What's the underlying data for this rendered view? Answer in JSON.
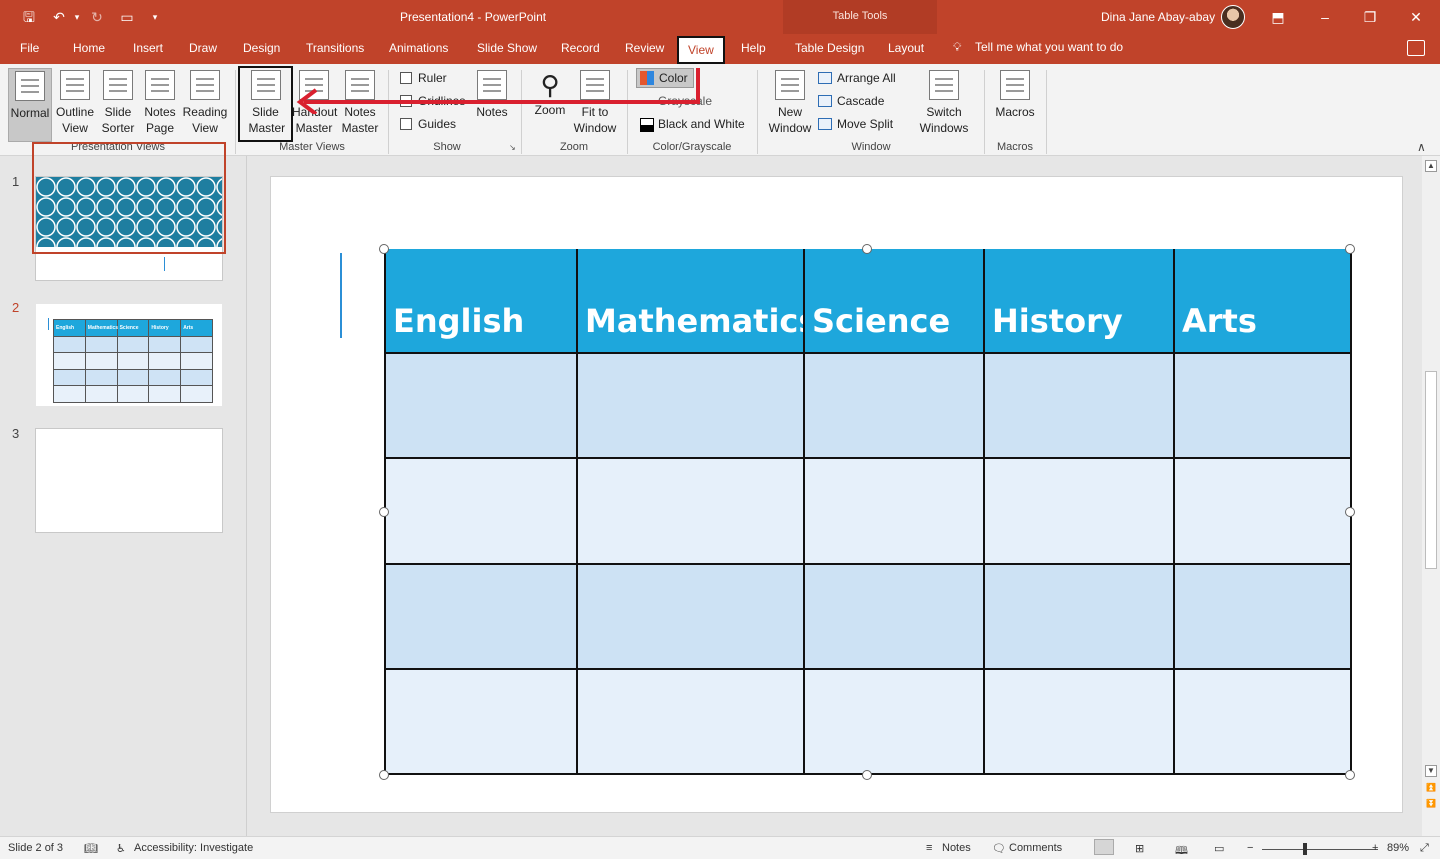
{
  "titlebar": {
    "title": "Presentation4  -  PowerPoint",
    "context_group": "Table Tools",
    "user_name": "Dina Jane Abay-abay"
  },
  "tabs": [
    "File",
    "Home",
    "Insert",
    "Draw",
    "Design",
    "Transitions",
    "Animations",
    "Slide Show",
    "Record",
    "Review",
    "View",
    "Help",
    "Table Design",
    "Layout"
  ],
  "active_tab": "View",
  "tell_me": "Tell me what you want to do",
  "ribbon": {
    "presentation_views": {
      "label": "Presentation Views",
      "buttons": [
        "Normal",
        "Outline View",
        "Slide Sorter",
        "Notes Page",
        "Reading View"
      ]
    },
    "master_views": {
      "label": "Master Views",
      "slide_master": "Slide Master",
      "handout_master": "Handout Master",
      "notes_master": "Notes Master"
    },
    "show": {
      "label": "Show",
      "ruler": "Ruler",
      "gridlines": "Gridlines",
      "guides": "Guides",
      "notes": "Notes"
    },
    "zoom": {
      "label": "Zoom",
      "zoom": "Zoom",
      "fit": "Fit to Window"
    },
    "color": {
      "label": "Color/Grayscale",
      "color": "Color",
      "grayscale": "Grayscale",
      "bw": "Black and White"
    },
    "window": {
      "label": "Window",
      "new_window": "New Window",
      "arrange_all": "Arrange All",
      "cascade": "Cascade",
      "move_split": "Move Split",
      "switch_windows": "Switch Windows"
    },
    "macros": {
      "label": "Macros",
      "macros": "Macros"
    }
  },
  "slides": {
    "numbers": [
      "1",
      "2",
      "3"
    ],
    "selected": "2"
  },
  "table": {
    "headers": [
      "English",
      "Mathematics",
      "Science",
      "History",
      "Arts"
    ],
    "rows": 4
  },
  "statusbar": {
    "slide_info": "Slide 2 of 3",
    "accessibility": "Accessibility: Investigate",
    "notes": "Notes",
    "comments": "Comments",
    "zoom": "89%"
  },
  "colors": {
    "brand": "#c0432a",
    "table_header": "#1ea7dc",
    "arrow": "#d9202f"
  }
}
